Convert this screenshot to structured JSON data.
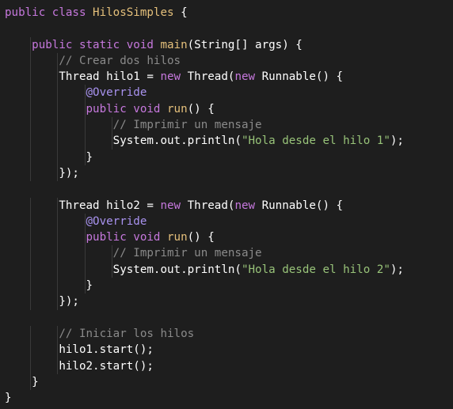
{
  "editor": {
    "lines": [
      [
        {
          "t": "public class ",
          "c": "kw"
        },
        {
          "t": "HilosSimples",
          "c": "type"
        },
        {
          "t": " {",
          "c": "plain"
        }
      ],
      [],
      [
        {
          "t": "    ",
          "c": "plain"
        },
        {
          "t": "public static void ",
          "c": "kw"
        },
        {
          "t": "main",
          "c": "fn"
        },
        {
          "t": "(String[] args) {",
          "c": "plain"
        }
      ],
      [
        {
          "t": "        ",
          "c": "plain"
        },
        {
          "t": "// Crear dos hilos",
          "c": "com"
        }
      ],
      [
        {
          "t": "        Thread hilo1 = ",
          "c": "plain"
        },
        {
          "t": "new",
          "c": "kw"
        },
        {
          "t": " Thread(",
          "c": "plain"
        },
        {
          "t": "new",
          "c": "kw"
        },
        {
          "t": " Runnable() {",
          "c": "plain"
        }
      ],
      [
        {
          "t": "            ",
          "c": "plain"
        },
        {
          "t": "@Override",
          "c": "ann"
        }
      ],
      [
        {
          "t": "            ",
          "c": "plain"
        },
        {
          "t": "public void ",
          "c": "kw"
        },
        {
          "t": "run",
          "c": "fn"
        },
        {
          "t": "() {",
          "c": "plain"
        }
      ],
      [
        {
          "t": "                ",
          "c": "plain"
        },
        {
          "t": "// Imprimir un mensaje",
          "c": "com"
        }
      ],
      [
        {
          "t": "                System.out.println(",
          "c": "plain"
        },
        {
          "t": "\"Hola desde el hilo 1\"",
          "c": "str"
        },
        {
          "t": ");",
          "c": "plain"
        }
      ],
      [
        {
          "t": "            }",
          "c": "plain"
        }
      ],
      [
        {
          "t": "        });",
          "c": "plain"
        }
      ],
      [],
      [
        {
          "t": "        Thread hilo2 = ",
          "c": "plain"
        },
        {
          "t": "new",
          "c": "kw"
        },
        {
          "t": " Thread(",
          "c": "plain"
        },
        {
          "t": "new",
          "c": "kw"
        },
        {
          "t": " Runnable() {",
          "c": "plain"
        }
      ],
      [
        {
          "t": "            ",
          "c": "plain"
        },
        {
          "t": "@Override",
          "c": "ann"
        }
      ],
      [
        {
          "t": "            ",
          "c": "plain"
        },
        {
          "t": "public void ",
          "c": "kw"
        },
        {
          "t": "run",
          "c": "fn"
        },
        {
          "t": "() {",
          "c": "plain"
        }
      ],
      [
        {
          "t": "                ",
          "c": "plain"
        },
        {
          "t": "// Imprimir un mensaje",
          "c": "com"
        }
      ],
      [
        {
          "t": "                System.out.println(",
          "c": "plain"
        },
        {
          "t": "\"Hola desde el hilo 2\"",
          "c": "str"
        },
        {
          "t": ");",
          "c": "plain"
        }
      ],
      [
        {
          "t": "            }",
          "c": "plain"
        }
      ],
      [
        {
          "t": "        });",
          "c": "plain"
        }
      ],
      [],
      [
        {
          "t": "        ",
          "c": "plain"
        },
        {
          "t": "// Iniciar los hilos",
          "c": "com"
        }
      ],
      [
        {
          "t": "        hilo1.start();",
          "c": "plain"
        }
      ],
      [
        {
          "t": "        hilo2.start();",
          "c": "plain"
        }
      ],
      [
        {
          "t": "    }",
          "c": "plain"
        }
      ],
      [
        {
          "t": "}",
          "c": "plain"
        }
      ]
    ]
  },
  "theme": {
    "background": "#1e1e1e",
    "keyword": "#c678dd",
    "type": "#e5c07b",
    "annotation": "#a993f0",
    "string": "#98c379",
    "comment": "#8a8a8a",
    "plain": "#ffffff"
  }
}
